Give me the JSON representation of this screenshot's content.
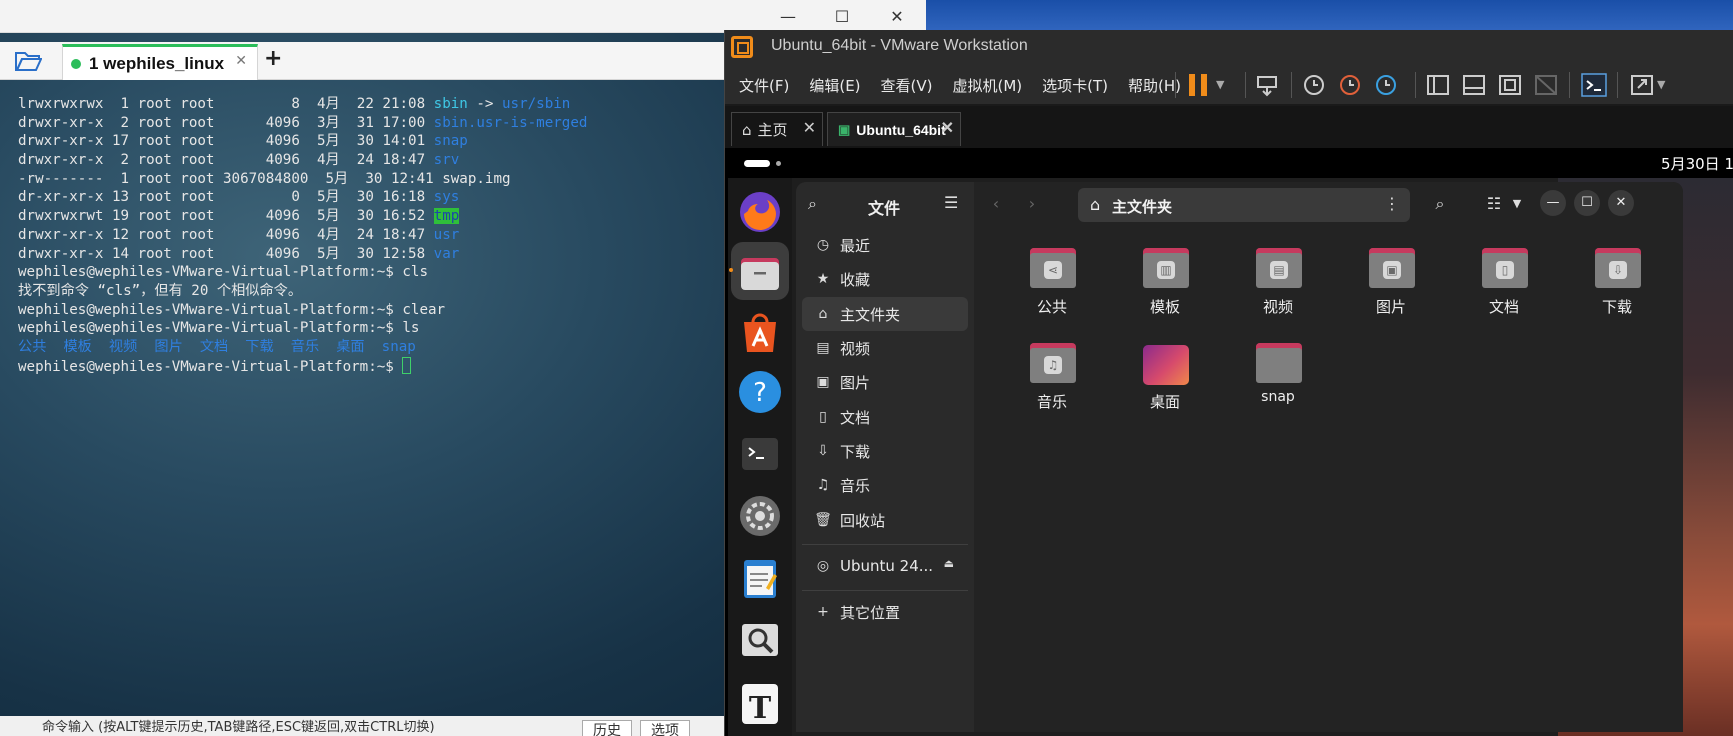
{
  "terminal": {
    "tab_label": "1 wephiles_linux",
    "add_tab_label": "+",
    "lines": [
      {
        "perm": "lrwxrwxrwx",
        "rest": "  1 root root         8  4月  22 21:08 ",
        "name": "sbin",
        "arrow": " -> ",
        "target": "usr/sbin"
      },
      {
        "perm": "drwxr-xr-x",
        "rest": "  2 root root      4096  3月  31 17:00 ",
        "name": "sbin.usr-is-merged"
      },
      {
        "perm": "drwxr-xr-x",
        "rest": " 17 root root      4096  5月  30 14:01 ",
        "name": "snap"
      },
      {
        "perm": "drwxr-xr-x",
        "rest": "  2 root root      4096  4月  24 18:47 ",
        "name": "srv"
      },
      {
        "perm": "-rw-------",
        "rest": "  1 root root 3067084800  5月  30 12:41 ",
        "name": "swap.img"
      },
      {
        "perm": "dr-xr-xr-x",
        "rest": " 13 root root         0  5月  30 16:18 ",
        "name": "sys"
      },
      {
        "perm": "drwxrwxrwt",
        "rest": " 19 root root      4096  5月  30 16:52 ",
        "name": "tmp"
      },
      {
        "perm": "drwxr-xr-x",
        "rest": " 12 root root      4096  4月  24 18:47 ",
        "name": "usr"
      },
      {
        "perm": "drwxr-xr-x",
        "rest": " 14 root root      4096  5月  30 12:58 ",
        "name": "var"
      }
    ],
    "prompt1": "wephiles@wephiles-VMware-Virtual-Platform:~$ cls",
    "error": "找不到命令 “cls”，但有 20 个相似命令。",
    "prompt2": "wephiles@wephiles-VMware-Virtual-Platform:~$ clear",
    "prompt3": "wephiles@wephiles-VMware-Virtual-Platform:~$ ls",
    "ls_output": "公共  模板  视频  图片  文档  下载  音乐  桌面  snap",
    "prompt4": "wephiles@wephiles-VMware-Virtual-Platform:~$ ",
    "status_text": "命令输入 (按ALT键提示历史,TAB键路径,ESC键返回,双击CTRL切换)",
    "history_btn": "历史",
    "options_btn": "选项"
  },
  "vmware": {
    "title": "Ubuntu_64bit - VMware Workstation",
    "menu": [
      "文件(F)",
      "编辑(E)",
      "查看(V)",
      "虚拟机(M)",
      "选项卡(T)",
      "帮助(H)"
    ],
    "tabs": [
      {
        "label": "主页"
      },
      {
        "label": "Ubuntu_64bit"
      }
    ]
  },
  "ubuntu": {
    "clock": "5月30日 1",
    "files": {
      "title": "文件",
      "path": "主文件夹",
      "sidebar": [
        {
          "label": "最近",
          "icon": "clock-icon"
        },
        {
          "label": "收藏",
          "icon": "star-icon"
        },
        {
          "label": "主文件夹",
          "icon": "home-icon"
        },
        {
          "label": "视频",
          "icon": "video-icon"
        },
        {
          "label": "图片",
          "icon": "image-icon"
        },
        {
          "label": "文档",
          "icon": "document-icon"
        },
        {
          "label": "下载",
          "icon": "download-icon"
        },
        {
          "label": "音乐",
          "icon": "music-icon"
        },
        {
          "label": "回收站",
          "icon": "trash-icon"
        }
      ],
      "drive": "Ubuntu 24...",
      "other": "其它位置",
      "items": [
        {
          "label": "公共",
          "icon": "share-icon"
        },
        {
          "label": "模板",
          "icon": "template-icon"
        },
        {
          "label": "视频",
          "icon": "video-icon"
        },
        {
          "label": "图片",
          "icon": "image-icon"
        },
        {
          "label": "文档",
          "icon": "document-icon"
        },
        {
          "label": "下载",
          "icon": "download-icon"
        },
        {
          "label": "音乐",
          "icon": "music-icon"
        },
        {
          "label": "桌面",
          "icon": "desktop-icon"
        },
        {
          "label": "snap",
          "icon": "folder-icon"
        }
      ]
    }
  }
}
